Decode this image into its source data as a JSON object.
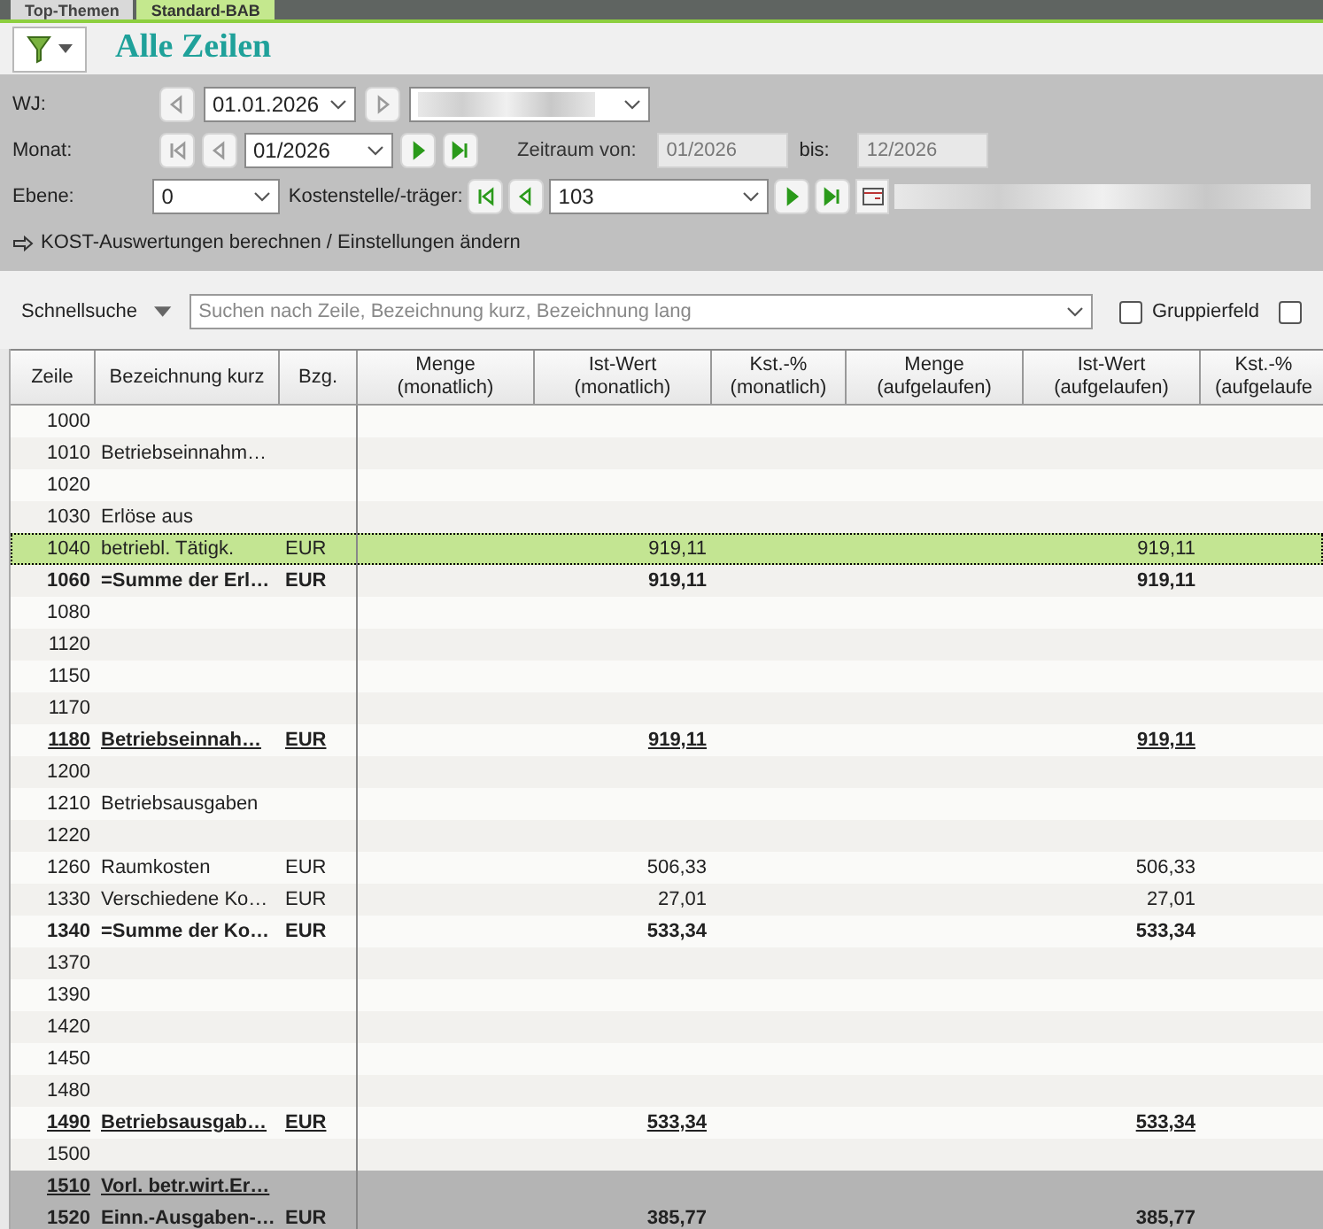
{
  "tabs": [
    {
      "label": "Top-Themen",
      "selected": false
    },
    {
      "label": "Standard-BAB",
      "selected": true
    }
  ],
  "title": "Alle Zeilen",
  "filters": {
    "wj_label": "WJ:",
    "wj_value": "01.01.2026",
    "monat_label": "Monat:",
    "monat_value": "01/2026",
    "zeitraum_label": "Zeitraum von:",
    "zeitraum_von": "01/2026",
    "bis_label": "bis:",
    "zeitraum_bis": "12/2026",
    "ebene_label": "Ebene:",
    "ebene_value": "0",
    "kostenstelle_label": "Kostenstelle/-träger:",
    "kostenstelle_value": "103",
    "action_link": "KOST-Auswertungen berechnen / Einstellungen ändern"
  },
  "quick_search": {
    "label": "Schnellsuche",
    "placeholder": "Suchen nach Zeile, Bezeichnung kurz, Bezeichnung lang",
    "group_field": {
      "label": "Gruppierfeld",
      "checked": false
    },
    "second_checkbox": {
      "checked": false
    }
  },
  "table": {
    "columns": [
      "Zeile",
      "Bezeichnung kurz",
      "Bzg.",
      "Menge\n(monatlich)",
      "Ist-Wert\n(monatlich)",
      "Kst.-%\n(monatlich)",
      "Menge\n(aufgelaufen)",
      "Ist-Wert\n(aufgelaufen)",
      "Kst.-%\n(aufgelaufe"
    ],
    "rows": [
      {
        "kind": "normal",
        "selected": false,
        "cells": [
          "1000",
          "",
          "",
          "",
          "",
          "",
          "",
          "",
          ""
        ]
      },
      {
        "kind": "normal",
        "selected": false,
        "cells": [
          "1010",
          "Betriebseinnahm…",
          "",
          "",
          "",
          "",
          "",
          "",
          ""
        ]
      },
      {
        "kind": "normal",
        "selected": false,
        "cells": [
          "1020",
          "",
          "",
          "",
          "",
          "",
          "",
          "",
          ""
        ]
      },
      {
        "kind": "normal",
        "selected": false,
        "cells": [
          "1030",
          "Erlöse aus",
          "",
          "",
          "",
          "",
          "",
          "",
          ""
        ]
      },
      {
        "kind": "normal",
        "selected": true,
        "cells": [
          "1040",
          "betriebl. Tätigk.",
          "EUR",
          "",
          "919,11",
          "",
          "",
          "919,11",
          ""
        ]
      },
      {
        "kind": "bold",
        "selected": false,
        "cells": [
          "1060",
          "=Summe der Erl…",
          "EUR",
          "",
          "919,11",
          "",
          "",
          "919,11",
          ""
        ]
      },
      {
        "kind": "normal",
        "selected": false,
        "cells": [
          "1080",
          "",
          "",
          "",
          "",
          "",
          "",
          "",
          ""
        ]
      },
      {
        "kind": "normal",
        "selected": false,
        "cells": [
          "1120",
          "",
          "",
          "",
          "",
          "",
          "",
          "",
          ""
        ]
      },
      {
        "kind": "normal",
        "selected": false,
        "cells": [
          "1150",
          "",
          "",
          "",
          "",
          "",
          "",
          "",
          ""
        ]
      },
      {
        "kind": "normal",
        "selected": false,
        "cells": [
          "1170",
          "",
          "",
          "",
          "",
          "",
          "",
          "",
          ""
        ]
      },
      {
        "kind": "total",
        "selected": false,
        "cells": [
          "1180",
          "Betriebseinnah…",
          "EUR",
          "",
          "919,11",
          "",
          "",
          "919,11",
          ""
        ]
      },
      {
        "kind": "normal",
        "selected": false,
        "cells": [
          "1200",
          "",
          "",
          "",
          "",
          "",
          "",
          "",
          ""
        ]
      },
      {
        "kind": "normal",
        "selected": false,
        "cells": [
          "1210",
          "Betriebsausgaben",
          "",
          "",
          "",
          "",
          "",
          "",
          ""
        ]
      },
      {
        "kind": "normal",
        "selected": false,
        "cells": [
          "1220",
          "",
          "",
          "",
          "",
          "",
          "",
          "",
          ""
        ]
      },
      {
        "kind": "normal",
        "selected": false,
        "cells": [
          "1260",
          "Raumkosten",
          "EUR",
          "",
          "506,33",
          "",
          "",
          "506,33",
          ""
        ]
      },
      {
        "kind": "normal",
        "selected": false,
        "cells": [
          "1330",
          "Verschiedene Ko…",
          "EUR",
          "",
          "27,01",
          "",
          "",
          "27,01",
          ""
        ]
      },
      {
        "kind": "bold",
        "selected": false,
        "cells": [
          "1340",
          "=Summe der Ko…",
          "EUR",
          "",
          "533,34",
          "",
          "",
          "533,34",
          ""
        ]
      },
      {
        "kind": "normal",
        "selected": false,
        "cells": [
          "1370",
          "",
          "",
          "",
          "",
          "",
          "",
          "",
          ""
        ]
      },
      {
        "kind": "normal",
        "selected": false,
        "cells": [
          "1390",
          "",
          "",
          "",
          "",
          "",
          "",
          "",
          ""
        ]
      },
      {
        "kind": "normal",
        "selected": false,
        "cells": [
          "1420",
          "",
          "",
          "",
          "",
          "",
          "",
          "",
          ""
        ]
      },
      {
        "kind": "normal",
        "selected": false,
        "cells": [
          "1450",
          "",
          "",
          "",
          "",
          "",
          "",
          "",
          ""
        ]
      },
      {
        "kind": "normal",
        "selected": false,
        "cells": [
          "1480",
          "",
          "",
          "",
          "",
          "",
          "",
          "",
          ""
        ]
      },
      {
        "kind": "total",
        "selected": false,
        "cells": [
          "1490",
          "Betriebsausgab…",
          "EUR",
          "",
          "533,34",
          "",
          "",
          "533,34",
          ""
        ]
      },
      {
        "kind": "normal",
        "selected": false,
        "cells": [
          "1500",
          "",
          "",
          "",
          "",
          "",
          "",
          "",
          ""
        ]
      },
      {
        "kind": "section",
        "selected": false,
        "cells": [
          "1510",
          "Vorl. betr.wirt.Er…",
          "",
          "",
          "",
          "",
          "",
          "",
          ""
        ]
      },
      {
        "kind": "section_bold",
        "selected": false,
        "cells": [
          "1520",
          "Einn.-Ausgaben-…",
          "EUR",
          "",
          "385,77",
          "",
          "",
          "385,77",
          ""
        ]
      }
    ]
  }
}
